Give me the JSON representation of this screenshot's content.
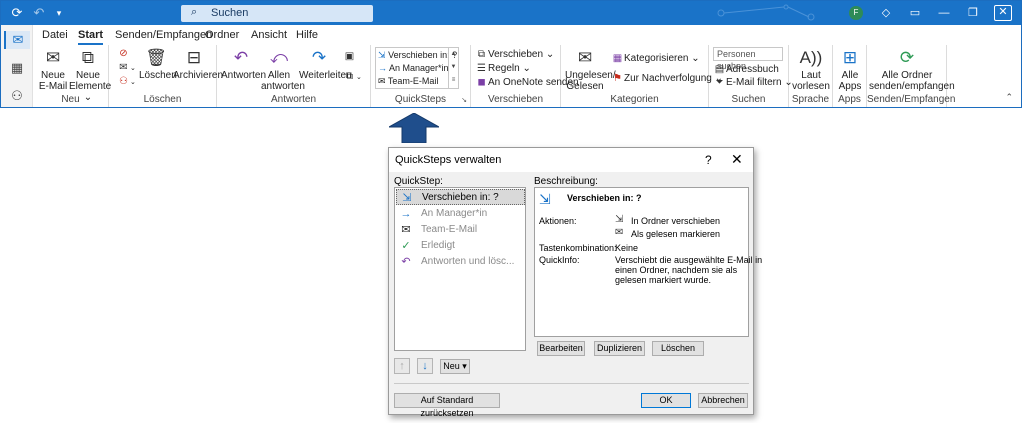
{
  "outlook": {
    "search_placeholder": "Suchen",
    "avatar_initial": "F",
    "tabs": [
      "Datei",
      "Start",
      "Senden/Empfangen",
      "Ordner",
      "Ansicht",
      "Hilfe"
    ],
    "groups": {
      "neu": {
        "label": "Neu",
        "new_email": "Neue E-Mail",
        "new_items": "Neue Elemente ⌄"
      },
      "loeschen": {
        "label": "Löschen",
        "delete": "Löschen",
        "archive": "Archivieren"
      },
      "antworten": {
        "label": "Antworten",
        "reply": "Antworten",
        "reply_all": "Allen antworten",
        "forward": "Weiterleiten"
      },
      "quicksteps": {
        "label": "QuickSteps",
        "items": [
          "Verschieben in: ?",
          "An Manager*in",
          "Team-E-Mail"
        ]
      },
      "verschieben": {
        "label": "Verschieben",
        "move": "Verschieben ⌄",
        "rules": "Regeln ⌄",
        "onenote": "An OneNote senden"
      },
      "kategorien": {
        "label": "Kategorien",
        "unread_read": "Ungelesen/ Gelesen",
        "categorize": "Kategorisieren ⌄",
        "followup": "Zur Nachverfolgung ⌄"
      },
      "suchen": {
        "label": "Suchen",
        "people_search": "Personen suchen",
        "address_book": "Adressbuch",
        "filter_email": "E-Mail filtern ⌄"
      },
      "sprache": {
        "label": "Sprache",
        "read_aloud": "Laut vorlesen"
      },
      "apps": {
        "label": "Apps",
        "all_apps": "Alle Apps"
      },
      "senden": {
        "label": "Senden/Empfangen",
        "send_all": "Alle Ordner senden/empfangen"
      }
    }
  },
  "dialog": {
    "title": "QuickSteps verwalten",
    "help": "?",
    "close": "✕",
    "quickstep_label": "QuickStep:",
    "description_label": "Beschreibung:",
    "quicksteps": [
      {
        "label": "Verschieben in: ?",
        "icon": "move-folder-icon",
        "selected": true
      },
      {
        "label": "An Manager*in",
        "icon": "arrow-right-icon",
        "selected": false
      },
      {
        "label": "Team-E-Mail",
        "icon": "envelope-icon",
        "selected": false
      },
      {
        "label": "Erledigt",
        "icon": "checkmark-icon",
        "selected": false
      },
      {
        "label": "Antworten und lösc...",
        "icon": "reply-icon",
        "selected": false
      }
    ],
    "description": {
      "name": "Verschieben in: ?",
      "actions_label": "Aktionen:",
      "action_1": "In Ordner verschieben",
      "action_2": "Als gelesen markieren",
      "shortcut_label": "Tastenkombination:",
      "shortcut_value": "Keine",
      "quickinfo_label": "QuickInfo:",
      "quickinfo_line1": "Verschiebt die ausgewählte E-Mail in",
      "quickinfo_line2": "einen Ordner, nachdem sie als",
      "quickinfo_line3": "gelesen markiert wurde."
    },
    "buttons": {
      "edit": "Bearbeiten",
      "duplicate": "Duplizieren",
      "delete": "Löschen",
      "new": "Neu ▾",
      "reset": "Auf Standard zurücksetzen",
      "ok": "OK",
      "cancel": "Abbrechen"
    }
  },
  "colors": {
    "titlebar": "#1a73c8",
    "arrow": "#1f4e8c",
    "accent": "#1a73c8"
  }
}
